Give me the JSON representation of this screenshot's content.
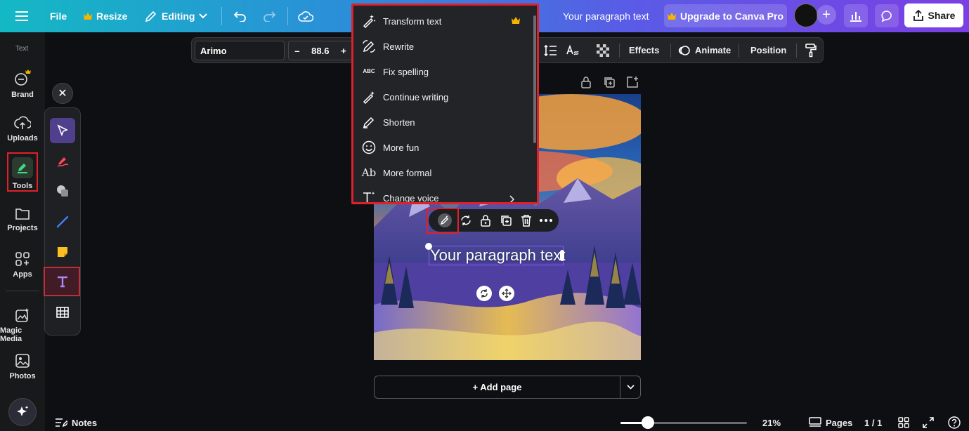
{
  "topbar": {
    "file": "File",
    "resize": "Resize",
    "editing": "Editing",
    "doc_title": "Your paragraph text",
    "upgrade": "Upgrade to Canva Pro",
    "share": "Share"
  },
  "sidebar": {
    "section": "Text",
    "items": [
      {
        "label": "Brand",
        "icon": "brand-icon"
      },
      {
        "label": "Uploads",
        "icon": "upload-cloud-icon"
      },
      {
        "label": "Tools",
        "icon": "pen-tool-icon"
      },
      {
        "label": "Projects",
        "icon": "folder-icon"
      },
      {
        "label": "Apps",
        "icon": "apps-grid-icon"
      },
      {
        "label": "Magic Media",
        "icon": "magic-media-icon"
      },
      {
        "label": "Photos",
        "icon": "photo-icon"
      }
    ]
  },
  "toolbar": {
    "font": "Arimo",
    "size": "88.6",
    "minus": "–",
    "plus": "+",
    "effects": "Effects",
    "animate": "Animate",
    "position": "Position"
  },
  "magic_menu": {
    "items": [
      {
        "label": "Transform text",
        "icon": "magic-wand-icon"
      },
      {
        "label": "Rewrite",
        "icon": "rewrite-icon"
      },
      {
        "label": "Fix spelling",
        "icon": "spellcheck-icon"
      },
      {
        "label": "Continue writing",
        "icon": "continue-writing-icon"
      },
      {
        "label": "Shorten",
        "icon": "shorten-icon"
      },
      {
        "label": "More fun",
        "icon": "smiley-icon"
      },
      {
        "label": "More formal",
        "icon": "formal-ab-icon"
      },
      {
        "label": "Change voice",
        "icon": "change-voice-icon"
      }
    ],
    "spell_glyph": "ABC",
    "formal_glyph": "Ab"
  },
  "canvas": {
    "paragraph": "Your paragraph text"
  },
  "add_page": "+ Add page",
  "bottombar": {
    "notes": "Notes",
    "zoom": "21%",
    "pages": "Pages",
    "page_count": "1 / 1"
  },
  "colors": {
    "highlight": "#e0202a",
    "accent": "#8b5cf6",
    "crown": "#f5b400"
  }
}
